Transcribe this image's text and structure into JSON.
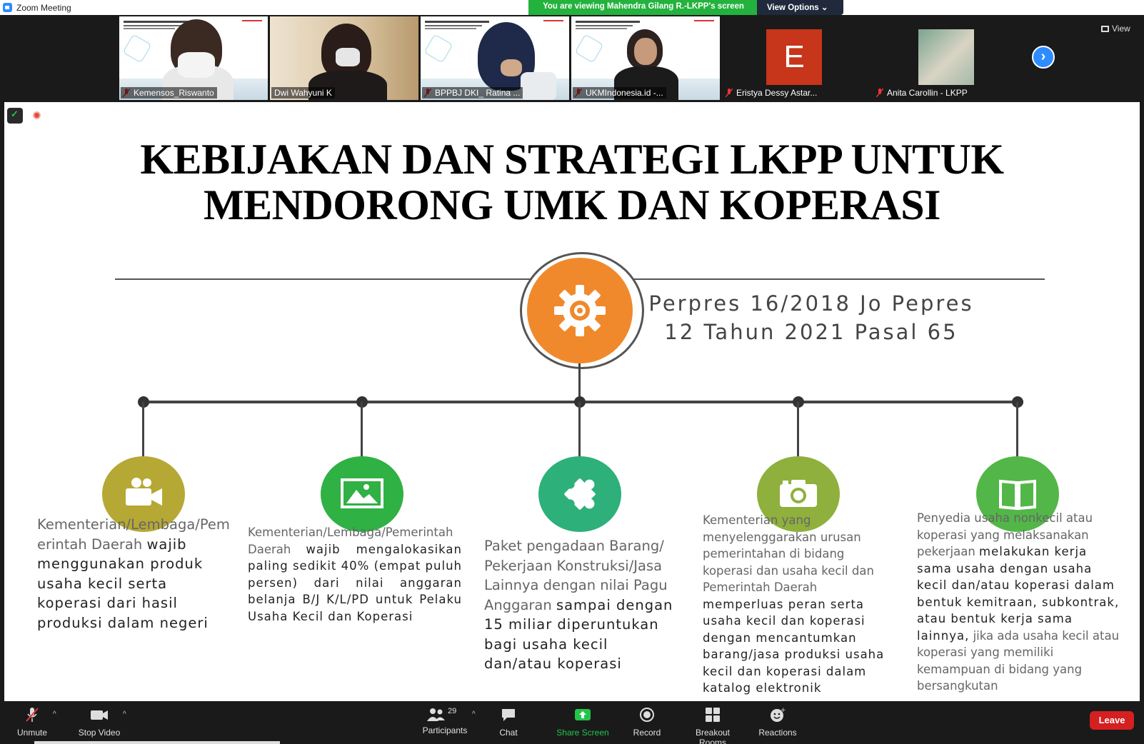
{
  "window": {
    "title": "Zoom Meeting"
  },
  "banner": {
    "viewing_text": "You are viewing Mahendra Gilang R.-LKPP's screen",
    "view_options": "View Options ⌄"
  },
  "participants": [
    {
      "name": "Kemensos_Riswanto"
    },
    {
      "name": "Dwi Wahyuni K"
    },
    {
      "name": "BPPBJ DKI_ Ratina ..."
    },
    {
      "name": "UKMIndonesia.id -..."
    },
    {
      "name": "Eristya Dessy Astar...",
      "avatar_letter": "E"
    },
    {
      "name": "Anita Carollin - LKPP"
    }
  ],
  "view_label": "View",
  "slide": {
    "title_line1": "KEBIJAKAN DAN STRATEGI LKPP UNTUK",
    "title_line2": "MENDORONG UMK DAN KOPERASI",
    "perpres_line1": "Perpres 16/2018 Jo Pepres",
    "perpres_line2": "12 Tahun 2021 Pasal 65",
    "columns": [
      {
        "light": "Kementerian/Lembaga/Pem erintah Daerah",
        "bold": "wajib menggunakan produk usaha kecil serta koperasi dari hasil produksi dalam negeri",
        "icon": "video-camera-icon",
        "color": "#b5a835"
      },
      {
        "light": "Kementerian/Lembaga/Pemerintah Daerah",
        "bold": "wajib mengalokasikan paling sedikit 40% (empat puluh persen) dari nilai anggaran belanja B/J K/L/PD untuk Pelaku Usaha Kecil dan Koperasi",
        "icon": "image-icon",
        "color": "#2fb144"
      },
      {
        "light": "Paket pengadaan Barang/ Pekerjaan Konstruksi/Jasa Lainnya dengan nilai Pagu Anggaran",
        "bold": "sampai dengan 15 miliar diperuntukan bagi usaha kecil dan/atau koperasi",
        "icon": "puzzle-icon",
        "color": "#2db07a"
      },
      {
        "light": "Kementerian yang menyelenggarakan urusan pemerintahan di bidang koperasi dan usaha kecil dan Pemerintah Daerah",
        "bold": "memperluas peran serta usaha kecil dan koperasi dengan mencantumkan barang/jasa produksi usaha kecil dan koperasi dalam katalog elektronik",
        "icon": "camera-icon",
        "color": "#8fb03c"
      },
      {
        "light": "Penyedia usaha nonkecil atau koperasi yang melaksanakan pekerjaan",
        "bold": "melakukan kerja sama usaha dengan usaha kecil dan/atau koperasi dalam bentuk kemitraan, subkontrak, atau bentuk kerja sama lainnya,",
        "light2": "jika ada usaha kecil atau koperasi yang memiliki kemampuan di bidang yang bersangkutan",
        "icon": "book-icon",
        "color": "#52b748"
      }
    ]
  },
  "toolbar": {
    "unmute": "Unmute",
    "stop_video": "Stop Video",
    "participants": "Participants",
    "participants_count": "29",
    "chat": "Chat",
    "share_screen": "Share Screen",
    "record": "Record",
    "breakout": "Breakout Rooms",
    "reactions": "Reactions",
    "leave": "Leave"
  }
}
